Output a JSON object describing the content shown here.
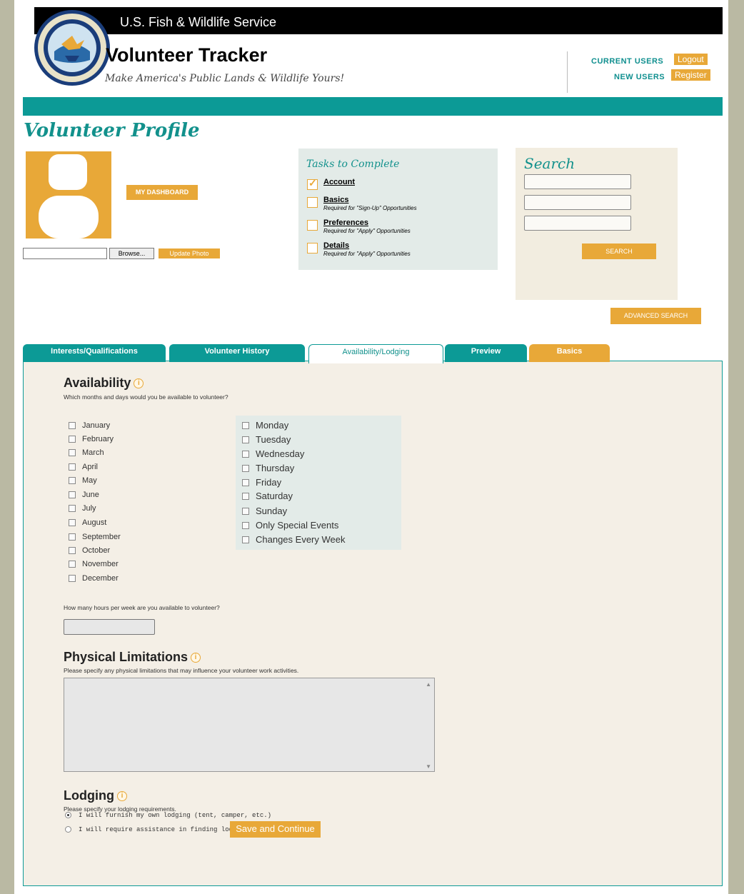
{
  "header": {
    "agency": "U.S. Fish & Wildlife Service",
    "app_title": "Volunteer Tracker",
    "tagline": "Make America's Public Lands & Wildlife Yours!",
    "logo_icon": "usfws-volunteer-seal-icon",
    "current_users_label": "CURRENT USERS",
    "logout_label": "Logout",
    "new_users_label": "NEW USERS",
    "register_label": "Register"
  },
  "page_title": "Volunteer Profile",
  "profile": {
    "avatar_icon": "person-silhouette-icon",
    "dashboard_label": "MY DASHBOARD",
    "browse_label": "Browse...",
    "update_photo_label": "Update Photo"
  },
  "tasks": {
    "title": "Tasks to Complete",
    "items": [
      {
        "label": "Account",
        "note": "",
        "checked": true
      },
      {
        "label": "Basics",
        "note": "Required for \"Sign-Up\" Opportunities",
        "checked": false
      },
      {
        "label": "Preferences",
        "note": "Required for \"Apply\" Opportunities",
        "checked": false
      },
      {
        "label": "Details",
        "note": "Required for \"Apply\" Opportunities",
        "checked": false
      }
    ]
  },
  "search": {
    "title": "Search",
    "button_label": "SEARCH",
    "advanced_label": "ADVANCED SEARCH"
  },
  "tabs": [
    {
      "label": "Interests/Qualifications"
    },
    {
      "label": "Volunteer History"
    },
    {
      "label": "Availability/Lodging"
    },
    {
      "label": "Preview"
    },
    {
      "label": "Basics"
    }
  ],
  "availability": {
    "title": "Availability",
    "prompt": "Which months and days would you be available to volunteer?",
    "months": [
      "January",
      "February",
      "March",
      "April",
      "May",
      "June",
      "July",
      "August",
      "September",
      "October",
      "November",
      "December"
    ],
    "days": [
      "Monday",
      "Tuesday",
      "Wednesday",
      "Thursday",
      "Friday",
      "Saturday",
      "Sunday",
      "Only Special Events",
      "Changes Every Week"
    ],
    "hours_prompt": "How many hours per week are you available to volunteer?"
  },
  "limitations": {
    "title": "Physical Limitations",
    "prompt": "Please specify any physical limitations that may influence your volunteer work activities."
  },
  "lodging": {
    "title": "Lodging",
    "prompt": "Please specify your lodging requirements.",
    "options": [
      {
        "label": "I will furnish my own lodging (tent, camper, etc.)",
        "selected": true
      },
      {
        "label": "I will require assistance in finding lodging",
        "selected": false
      }
    ],
    "save_label": "Save and Continue"
  },
  "colors": {
    "teal": "#0c9a96",
    "orange": "#e8a838",
    "panel_bg": "#f4efe6"
  }
}
